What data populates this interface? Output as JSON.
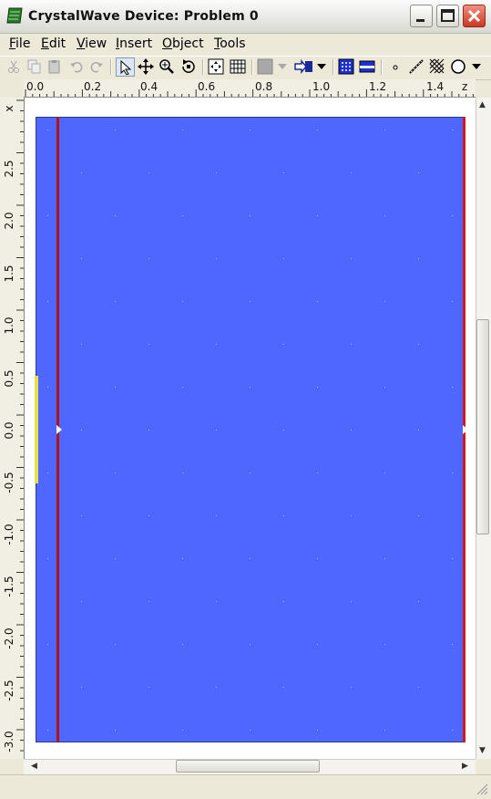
{
  "window": {
    "title": "CrystalWave Device: Problem 0",
    "buttons": {
      "minimize": "minimize",
      "maximize": "maximize",
      "close": "close"
    }
  },
  "menu": [
    {
      "label": "File",
      "accel": "F"
    },
    {
      "label": "Edit",
      "accel": "E"
    },
    {
      "label": "View",
      "accel": "V"
    },
    {
      "label": "Insert",
      "accel": "I"
    },
    {
      "label": "Object",
      "accel": "O"
    },
    {
      "label": "Tools",
      "accel": "T"
    }
  ],
  "toolbar": {
    "icons": [
      "cut-icon",
      "copy-icon",
      "paste-icon",
      "undo-icon",
      "redo-icon",
      "select-arrow-icon",
      "move-icon",
      "zoom-icon",
      "rotate-view-icon",
      "fit-view-icon",
      "grid-icon",
      "fill-color-icon",
      "export-icon",
      "crystal-fill-icon",
      "waveguide-icon",
      "point-icon",
      "line-draw-icon",
      "hatch-icon",
      "circle-shape-icon"
    ]
  },
  "rulers": {
    "horizontal": {
      "labels": [
        "0.0",
        "0.2",
        "0.4",
        "0.6",
        "0.8",
        "1.0",
        "1.2",
        "1.4"
      ],
      "axis_label": "z"
    },
    "vertical": {
      "labels": [
        "2.5",
        "2.0",
        "1.5",
        "1.0",
        "0.5",
        "0.0",
        "-0.5",
        "-1.0",
        "-1.5",
        "-2.0",
        "-2.5",
        "-3.0"
      ],
      "axis_label": "x"
    }
  },
  "colors": {
    "device_fill": "#4f67ff",
    "boundary_left": "#b01515",
    "boundary_right": "#d41818",
    "source": "#e6e048"
  }
}
